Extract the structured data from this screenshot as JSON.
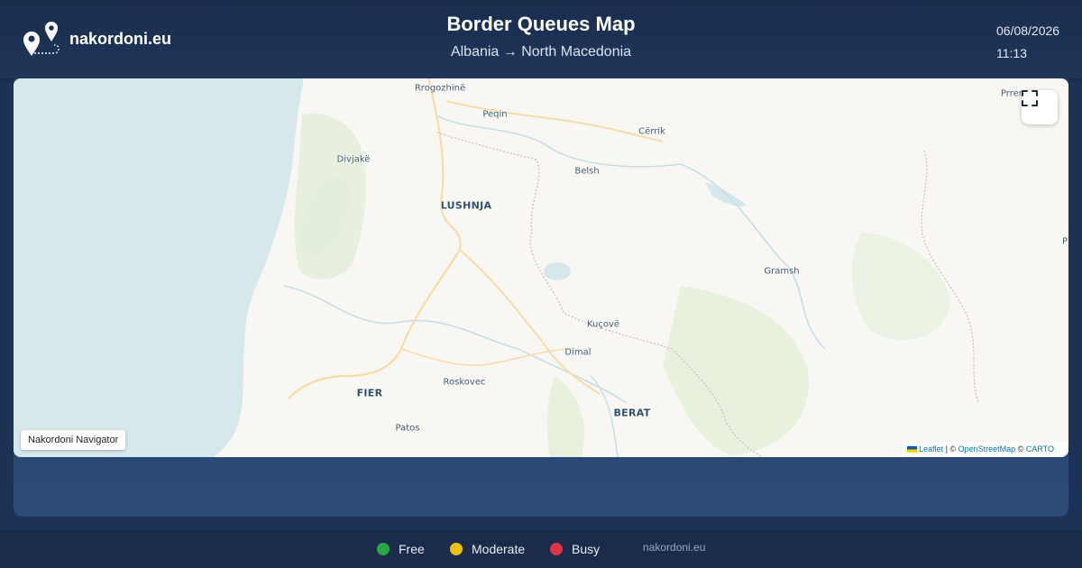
{
  "brand": {
    "name": "nakordoni.eu",
    "icon": "map-pins-icon"
  },
  "header": {
    "title": "Border Queues Map",
    "subtitle": "Albania → North Macedonia",
    "date": "06/08/2026",
    "time": "11:13"
  },
  "map": {
    "cities": [
      {
        "name": "Rrogozhinë",
        "major": false
      },
      {
        "name": "Peqin",
        "major": false
      },
      {
        "name": "Cërrik",
        "major": false
      },
      {
        "name": "Prren",
        "major": false
      },
      {
        "name": "Divjakë",
        "major": false
      },
      {
        "name": "Belsh",
        "major": false
      },
      {
        "name": "LUSHNJA",
        "major": true
      },
      {
        "name": "Gramsh",
        "major": false
      },
      {
        "name": "Kuçovë",
        "major": false
      },
      {
        "name": "Dimal",
        "major": false
      },
      {
        "name": "Roskovec",
        "major": false
      },
      {
        "name": "FIER",
        "major": true
      },
      {
        "name": "BERAT",
        "major": true
      },
      {
        "name": "Patos",
        "major": false
      },
      {
        "name": "P",
        "major": false
      }
    ],
    "fullscreen_icon": "fullscreen-icon",
    "navigator_label": "Nakordoni Navigator",
    "attribution": {
      "leaflet": "Leaflet",
      "separator": " | © ",
      "osm": "OpenStreetMap",
      "copy": " © ",
      "carto": "CARTO"
    }
  },
  "legend": [
    {
      "label": "Free",
      "color": "#28a745"
    },
    {
      "label": "Moderate",
      "color": "#f0c010"
    },
    {
      "label": "Busy",
      "color": "#dc3545"
    }
  ],
  "footer": {
    "site": "nakordoni.eu"
  }
}
